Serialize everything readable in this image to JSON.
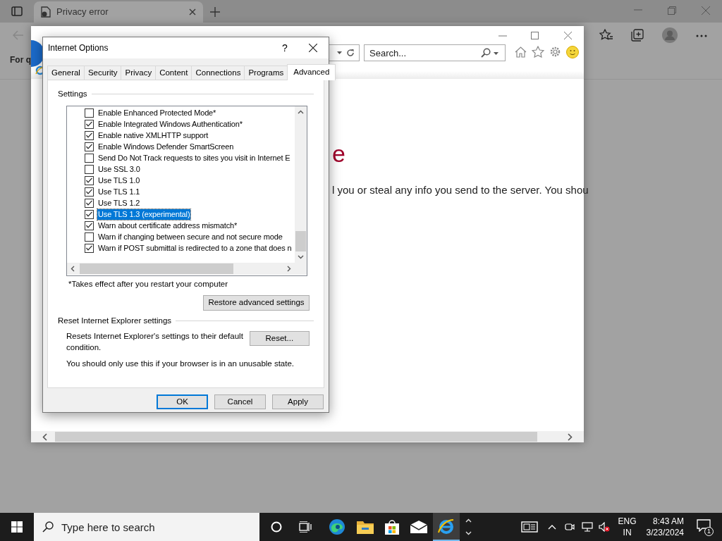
{
  "browser": {
    "tab_title": "Privacy error",
    "bookmark_text": "For q"
  },
  "ie_window": {
    "search_placeholder": "Search...",
    "page_heading": "e",
    "page_text": "l you or steal any info you send to the server. You shou"
  },
  "dialog": {
    "title": "Internet Options",
    "help": "?",
    "tabs": [
      {
        "label": "General",
        "selected": false
      },
      {
        "label": "Security",
        "selected": false
      },
      {
        "label": "Privacy",
        "selected": false
      },
      {
        "label": "Content",
        "selected": false
      },
      {
        "label": "Connections",
        "selected": false
      },
      {
        "label": "Programs",
        "selected": false
      },
      {
        "label": "Advanced",
        "selected": true
      }
    ],
    "settings_label": "Settings",
    "settings": [
      {
        "label": "Enable Enhanced Protected Mode*",
        "checked": false,
        "selected": false
      },
      {
        "label": "Enable Integrated Windows Authentication*",
        "checked": true,
        "selected": false
      },
      {
        "label": "Enable native XMLHTTP support",
        "checked": true,
        "selected": false
      },
      {
        "label": "Enable Windows Defender SmartScreen",
        "checked": true,
        "selected": false
      },
      {
        "label": "Send Do Not Track requests to sites you visit in Internet E",
        "checked": false,
        "selected": false
      },
      {
        "label": "Use SSL 3.0",
        "checked": false,
        "selected": false
      },
      {
        "label": "Use TLS 1.0",
        "checked": true,
        "selected": false
      },
      {
        "label": "Use TLS 1.1",
        "checked": true,
        "selected": false
      },
      {
        "label": "Use TLS 1.2",
        "checked": true,
        "selected": false
      },
      {
        "label": "Use TLS 1.3 (experimental)",
        "checked": true,
        "selected": true
      },
      {
        "label": "Warn about certificate address mismatch*",
        "checked": true,
        "selected": false
      },
      {
        "label": "Warn if changing between secure and not secure mode",
        "checked": false,
        "selected": false
      },
      {
        "label": "Warn if POST submittal is redirected to a zone that does n",
        "checked": true,
        "selected": false
      }
    ],
    "note": "*Takes effect after you restart your computer",
    "restore_button": "Restore advanced settings",
    "reset_group": "Reset Internet Explorer settings",
    "reset_description": "Resets Internet Explorer's settings to their default condition.",
    "reset_button": "Reset...",
    "warning": "You should only use this if your browser is in an unusable state.",
    "buttons": [
      {
        "label": "OK",
        "default": true
      },
      {
        "label": "Cancel",
        "default": false
      },
      {
        "label": "Apply",
        "default": false
      }
    ]
  },
  "taskbar": {
    "search_placeholder": "Type here to search",
    "language": "ENG",
    "region": "IN",
    "time": "8:43 AM",
    "date": "3/23/2024",
    "notification_count": "1"
  }
}
